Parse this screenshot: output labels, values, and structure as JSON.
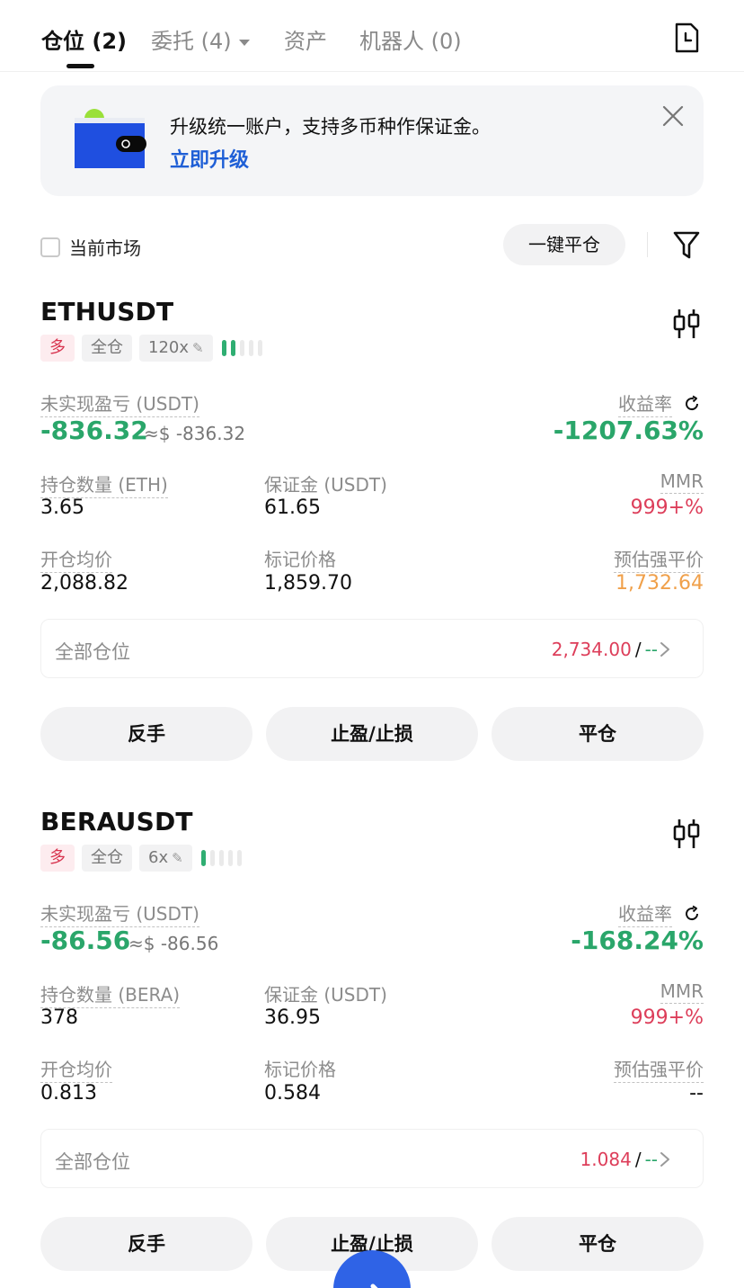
{
  "tabs": [
    {
      "label": "仓位 (2)"
    },
    {
      "label": "委托 (4)"
    },
    {
      "label": "资产"
    },
    {
      "label": "机器人 (0)"
    }
  ],
  "banner": {
    "text": "升级统一账户，支持多币种作保证金。",
    "link": "立即升级"
  },
  "filter": {
    "current_market": "当前市场",
    "close_all": "一键平仓"
  },
  "positions": [
    {
      "symbol": "ETHUSDT",
      "side": "多",
      "margin_mode": "全仓",
      "leverage": "120x",
      "adl_level": 2,
      "unrealized_label": "未实现盈亏 (USDT)",
      "unrealized_value": "-836.32",
      "unrealized_approx": "≈$ -836.32",
      "roe_label": "收益率",
      "roe_value": "-1207.63%",
      "qty_label": "持仓数量 (ETH)",
      "qty_value": "3.65",
      "margin_label": "保证金 (USDT)",
      "margin_value": "61.65",
      "mmr_label": "MMR",
      "mmr_value": "999+%",
      "entry_label": "开仓均价",
      "entry_value": "2,088.82",
      "mark_label": "标记价格",
      "mark_value": "1,859.70",
      "liq_label": "预估强平价",
      "liq_value": "1,732.64",
      "all_label": "全部仓位",
      "all_value": "2,734.00",
      "all_slash": "/",
      "all_dash": "--",
      "btn_reverse": "反手",
      "btn_tpsl": "止盈/止损",
      "btn_close": "平仓"
    },
    {
      "symbol": "BERAUSDT",
      "side": "多",
      "margin_mode": "全仓",
      "leverage": "6x",
      "adl_level": 1,
      "unrealized_label": "未实现盈亏 (USDT)",
      "unrealized_value": "-86.56",
      "unrealized_approx": "≈$ -86.56",
      "roe_label": "收益率",
      "roe_value": "-168.24%",
      "qty_label": "持仓数量 (BERA)",
      "qty_value": "378",
      "margin_label": "保证金 (USDT)",
      "margin_value": "36.95",
      "mmr_label": "MMR",
      "mmr_value": "999+%",
      "entry_label": "开仓均价",
      "entry_value": "0.813",
      "mark_label": "标记价格",
      "mark_value": "0.584",
      "liq_label": "预估强平价",
      "liq_value": "--",
      "all_label": "全部仓位",
      "all_value": "1.084",
      "all_slash": "/",
      "all_dash": "--",
      "btn_reverse": "反手",
      "btn_tpsl": "止盈/止损",
      "btn_close": "平仓"
    }
  ],
  "colors": {
    "profit_green": "#2aa66a",
    "loss_red": "#dd3e5a",
    "liq_orange": "#f0a04a",
    "link_blue": "#1f5fd6",
    "fab_blue": "#2f63e6"
  },
  "icons": {
    "history": "history-doc-icon",
    "close": "close-icon",
    "filter": "filter-funnel-icon",
    "chart": "candlestick-icon",
    "refresh": "refresh-icon",
    "chevron": "chevron-right-icon",
    "fab": "transfer-arrow-icon"
  }
}
